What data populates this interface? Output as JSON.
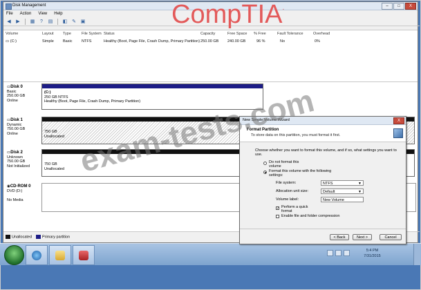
{
  "window": {
    "title": "Disk Management",
    "buttons": {
      "minimize": "–",
      "maximize": "□",
      "close": "X"
    }
  },
  "menu": [
    "File",
    "Action",
    "View",
    "Help"
  ],
  "toolbar_icons": [
    "back-arrow-icon",
    "forward-arrow-icon",
    "properties-icon",
    "help-icon",
    "refresh-icon",
    "console-icon",
    "settings-icon",
    "volume-icon"
  ],
  "volume_list": {
    "headers": [
      "Volume",
      "Layout",
      "Type",
      "File System",
      "Status",
      "Capacity",
      "Free Space",
      "% Free",
      "Fault Tolerance",
      "Overhead"
    ],
    "rows": [
      [
        "(C:)",
        "Simple",
        "Basic",
        "NTFS",
        "Healthy (Boot, Page File, Crash Dump, Primary Partition)",
        "250.00 GB",
        "240.00 GB",
        "96 %",
        "No",
        "0%"
      ]
    ]
  },
  "disks": [
    {
      "name": "Disk 0",
      "type": "Basic",
      "size": "250.00 GB",
      "status": "Online",
      "partition": {
        "title": "(C:)",
        "line1": "250 GB NTFS",
        "line2": "Healthy (Boot, Page File, Crash Dump, Primary Partition)"
      }
    },
    {
      "name": "Disk 1",
      "type": "Dynamic",
      "size": "750.00 GB",
      "status": "Online",
      "partition": {
        "line1": "750 GB",
        "line2": "Unallocated"
      }
    },
    {
      "name": "Disk 2",
      "type": "Unknown",
      "size": "750.00 GB",
      "status": "Not Initialized",
      "partition": {
        "line1": "750 GB",
        "line2": "Unallocated"
      }
    },
    {
      "name": "CD-ROM 0",
      "type": "DVD (D:)",
      "size": "",
      "status": "No Media"
    }
  ],
  "legend": {
    "unallocated": "Unallocated",
    "primary": "Primary partition"
  },
  "colors": {
    "primary": "#1c1c86",
    "unallocated": "#111111",
    "brand_watermark": "#e35a5a"
  },
  "wizard": {
    "title": "New Simple Volume Wizard",
    "heading": "Format Partition",
    "subheading": "To store data on this partition, you must format it first.",
    "prompt": "Choose whether you want to format this volume, and if so, what settings you want to use.",
    "option_no_format_1": "Do not format this",
    "option_no_format_2": "volume",
    "option_format_1": "Format this volume with the following",
    "option_format_2": "settings:",
    "file_system_label": "File system:",
    "file_system_value": "NTFS",
    "alloc_label": "Allocation unit size:",
    "alloc_value": "Default",
    "volume_label_label": "Volume label:",
    "volume_label_value": "New Volume",
    "quick_format_1": "Perform a quick",
    "quick_format_2": "format",
    "compression": "Enable file and folder compression",
    "back": "< Back",
    "next": "Next >",
    "cancel": "Cancel"
  },
  "taskbar": {
    "time": "5:4 PM",
    "date": "7/31/2015"
  },
  "watermarks": {
    "brand": "CompTIA",
    "brand_mark": ".",
    "site": "exam-tests.com"
  }
}
